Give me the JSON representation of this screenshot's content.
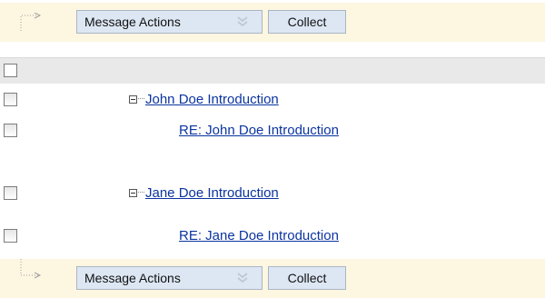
{
  "toolbar_top": {
    "actions_label": "Message Actions",
    "collect_label": "Collect"
  },
  "toolbar_bottom": {
    "actions_label": "Message Actions",
    "collect_label": "Collect"
  },
  "threads": [
    {
      "title": "John Doe Introduction",
      "is_parent": true
    },
    {
      "title": "RE: John Doe Introduction",
      "is_parent": false
    },
    {
      "title": "Jane Doe Introduction",
      "is_parent": true
    },
    {
      "title": "RE: Jane Doe Introduction",
      "is_parent": false
    }
  ],
  "colors": {
    "bar_bg": "#fdf6e1",
    "button_bg": "#dde7f4",
    "header_bg": "#e9e9e9",
    "link": "#0b34a0"
  }
}
